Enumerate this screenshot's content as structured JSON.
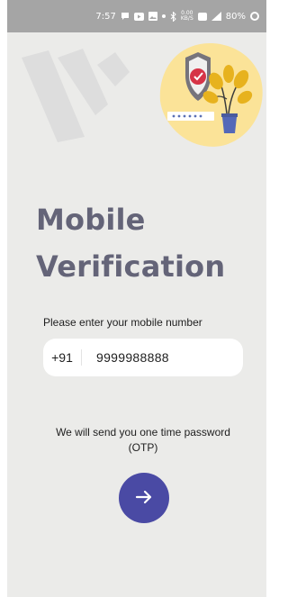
{
  "status_bar": {
    "time": "7:57",
    "data_speed": "0.00",
    "data_unit": "KB/S",
    "battery": "80%"
  },
  "page": {
    "title_line1": "Mobile",
    "title_line2": "Verification",
    "prompt": "Please enter your mobile number",
    "country_code": "+91",
    "mobile_number": "9999988888",
    "otp_note": "We will send you one time password (OTP)"
  },
  "icons": {
    "next": "arrow-right-icon",
    "logo": "brand-logo",
    "illustration": "security-shield-plant-illustration"
  },
  "colors": {
    "background": "#ebebe9",
    "title": "#646478",
    "accent": "#4a4aa4",
    "illustration_blob": "#fbe398",
    "status_bar": "#a5a5a5"
  }
}
